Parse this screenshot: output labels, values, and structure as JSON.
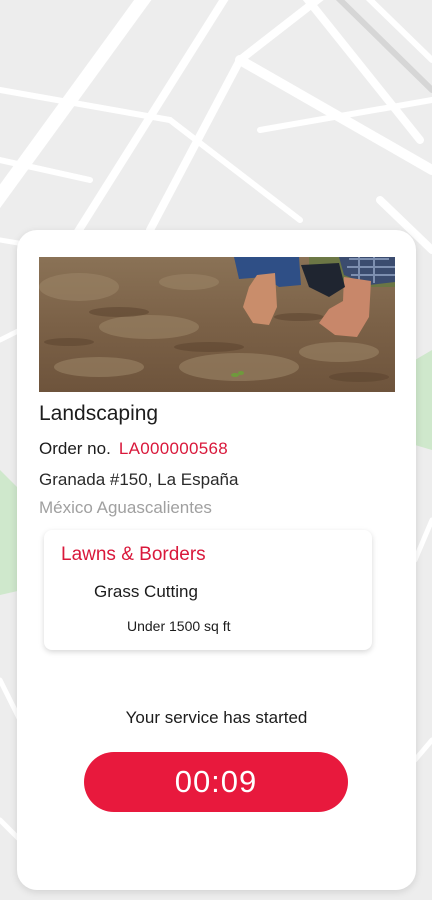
{
  "service": {
    "title": "Landscaping",
    "order_label": "Order no.",
    "order_number": "LA000000568",
    "address_line1": "Granada #150, La España",
    "address_line2": "México Aguascalientes"
  },
  "detail": {
    "category": "Lawns & Borders",
    "subservice": "Grass Cutting",
    "size": "Under 1500 sq ft"
  },
  "status": {
    "message": "Your service has started",
    "timer": "00:09"
  },
  "colors": {
    "accent": "#e8193d",
    "map_background": "#eeeeee",
    "map_roads": "#ffffff",
    "map_park": "#cfe8cc"
  }
}
